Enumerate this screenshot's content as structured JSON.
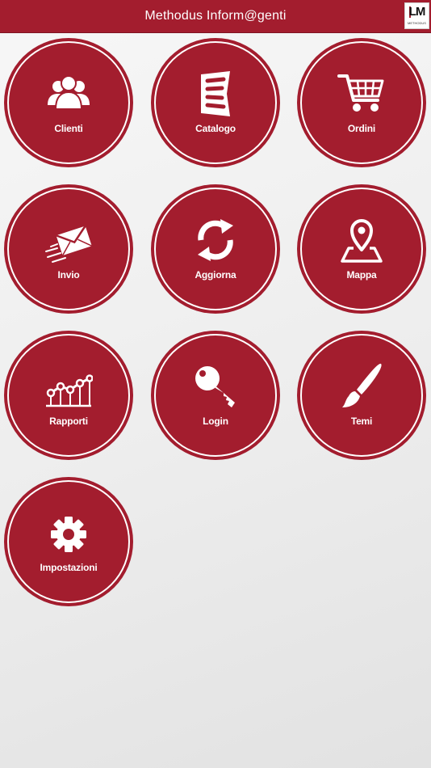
{
  "header": {
    "title": "Methodus Inform@genti",
    "logo": {
      "mark": "LM",
      "subtext": "METHODUS"
    }
  },
  "colors": {
    "brand": "#a31d2e",
    "icon": "#ffffff"
  },
  "menu": [
    {
      "label": "Clienti",
      "icon": "users-icon"
    },
    {
      "label": "Catalogo",
      "icon": "catalog-icon"
    },
    {
      "label": "Ordini",
      "icon": "cart-icon"
    },
    {
      "label": "Invio",
      "icon": "envelope-icon"
    },
    {
      "label": "Aggiorna",
      "icon": "refresh-icon"
    },
    {
      "label": "Mappa",
      "icon": "map-pin-icon"
    },
    {
      "label": "Rapporti",
      "icon": "chart-line-icon"
    },
    {
      "label": "Login",
      "icon": "key-icon"
    },
    {
      "label": "Temi",
      "icon": "paintbrush-icon"
    },
    {
      "label": "Impostazioni",
      "icon": "gear-icon"
    }
  ]
}
